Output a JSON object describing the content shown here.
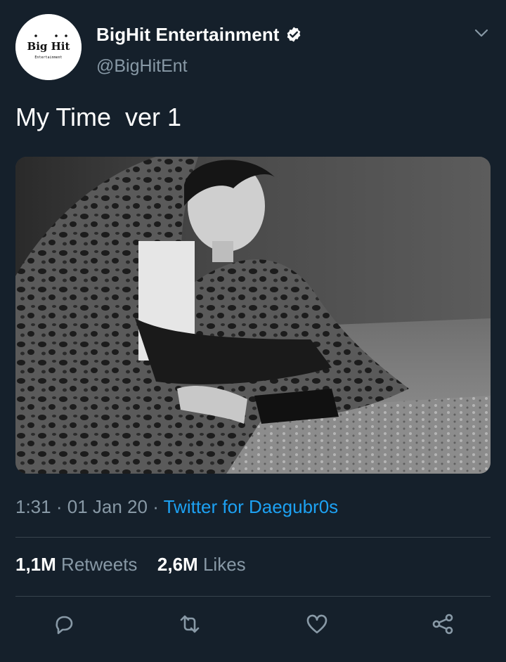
{
  "author": {
    "display_name": "BigHit Entertainment",
    "handle": "@BigHitEnt",
    "verified": true,
    "avatar_logo_text": "Big Hit",
    "avatar_logo_subtext": "Entertainment"
  },
  "tweet": {
    "text": "My Time  ver 1",
    "time": "1:31",
    "date": "01 Jan 20",
    "source": "Twitter for Daegubr0s"
  },
  "stats": {
    "retweets_count": "1,1M",
    "retweets_label": "Retweets",
    "likes_count": "2,6M",
    "likes_label": "Likes"
  },
  "colors": {
    "background": "#15202b",
    "secondary_text": "#8899a6",
    "accent": "#1da1f2",
    "divider": "#38444d"
  },
  "actions": [
    "reply-icon",
    "retweet-icon",
    "like-icon",
    "share-icon"
  ]
}
